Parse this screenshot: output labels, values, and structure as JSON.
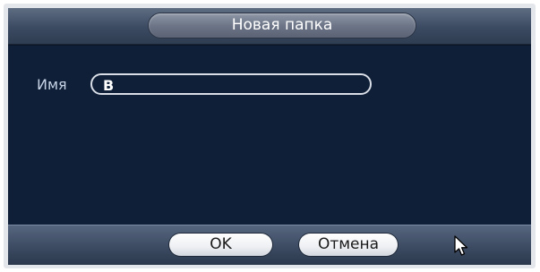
{
  "dialog": {
    "title": "Новая папка"
  },
  "form": {
    "name_label": "Имя",
    "name_value": "В"
  },
  "buttons": {
    "ok_label": "OK",
    "cancel_label": "Отмена"
  },
  "icons": {
    "pointer": "mouse-pointer-icon"
  }
}
